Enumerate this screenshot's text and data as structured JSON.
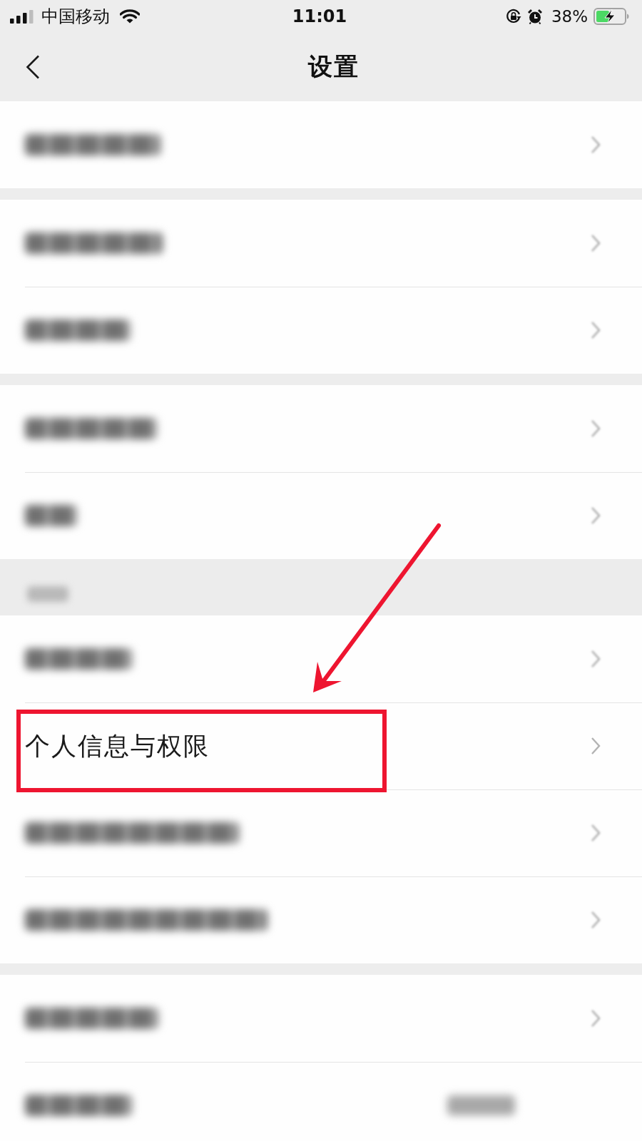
{
  "status_bar": {
    "carrier": "中国移动",
    "time": "11:01",
    "battery": "38%"
  },
  "nav_bar": {
    "title": "设置"
  },
  "sections": [
    {
      "rows": [
        {
          "kind": "blurred",
          "highlighted": false
        }
      ]
    },
    {
      "rows": [
        {
          "kind": "blurred",
          "highlighted": false
        },
        {
          "kind": "blurred",
          "highlighted": false
        }
      ]
    },
    {
      "rows": [
        {
          "kind": "blurred",
          "highlighted": false
        },
        {
          "kind": "blurred",
          "highlighted": false
        }
      ]
    },
    {
      "header": {
        "kind": "blurred"
      },
      "rows": [
        {
          "kind": "blurred",
          "highlighted": false
        },
        {
          "kind": "text",
          "label": "个人信息与权限",
          "highlighted": true
        },
        {
          "kind": "blurred",
          "highlighted": false
        },
        {
          "kind": "blurred",
          "highlighted": false
        }
      ]
    },
    {
      "rows": [
        {
          "kind": "blurred",
          "highlighted": false
        },
        {
          "kind": "blurred",
          "value": {
            "kind": "blurred"
          },
          "highlighted": false
        }
      ]
    }
  ]
}
